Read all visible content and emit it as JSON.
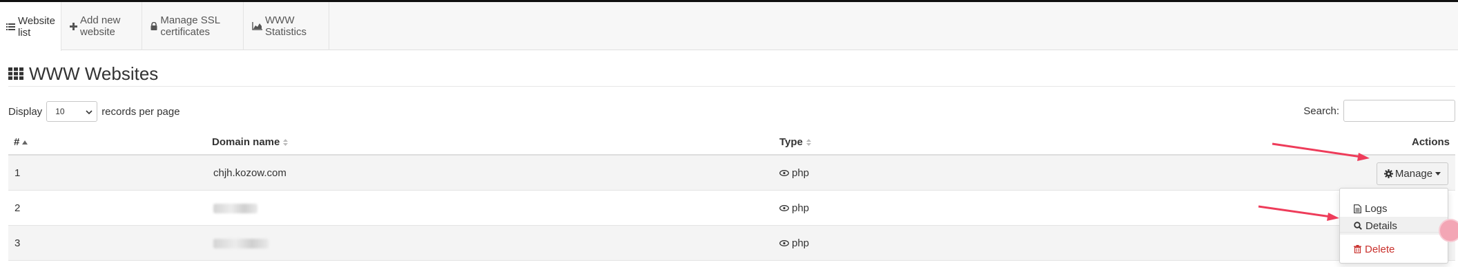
{
  "tabs": [
    {
      "label": "Website list",
      "icon": "list-icon",
      "active": true
    },
    {
      "label": "Add new website",
      "icon": "plus-icon",
      "active": false
    },
    {
      "label": "Manage SSL certificates",
      "icon": "lock-icon",
      "active": false
    },
    {
      "label": "WWW Statistics",
      "icon": "area-chart-icon",
      "active": false
    }
  ],
  "page": {
    "title": "WWW Websites",
    "title_icon": "grid-icon"
  },
  "controls": {
    "display_label": "Display",
    "page_size": "10",
    "records_label": "records per page",
    "search_label": "Search:",
    "search_value": ""
  },
  "table": {
    "columns": [
      "#",
      "Domain name",
      "Type",
      "Actions"
    ],
    "sort_column": "#",
    "rows": [
      {
        "num": "1",
        "domain": "chjh.kozow.com",
        "type": "php",
        "domain_blurred": false
      },
      {
        "num": "2",
        "domain": "",
        "type": "php",
        "domain_blurred": true
      },
      {
        "num": "3",
        "domain": "",
        "type": "php",
        "domain_blurred": true
      }
    ]
  },
  "actions": {
    "manage_label": "Manage",
    "menu": [
      {
        "label": "Logs",
        "icon": "file-icon"
      },
      {
        "label": "Details",
        "icon": "search-icon"
      },
      {
        "label": "Delete",
        "icon": "trash-icon"
      }
    ]
  },
  "colors": {
    "annotation_arrow": "#ee3c5a",
    "delete": "#c9302c",
    "text": "#333333"
  }
}
